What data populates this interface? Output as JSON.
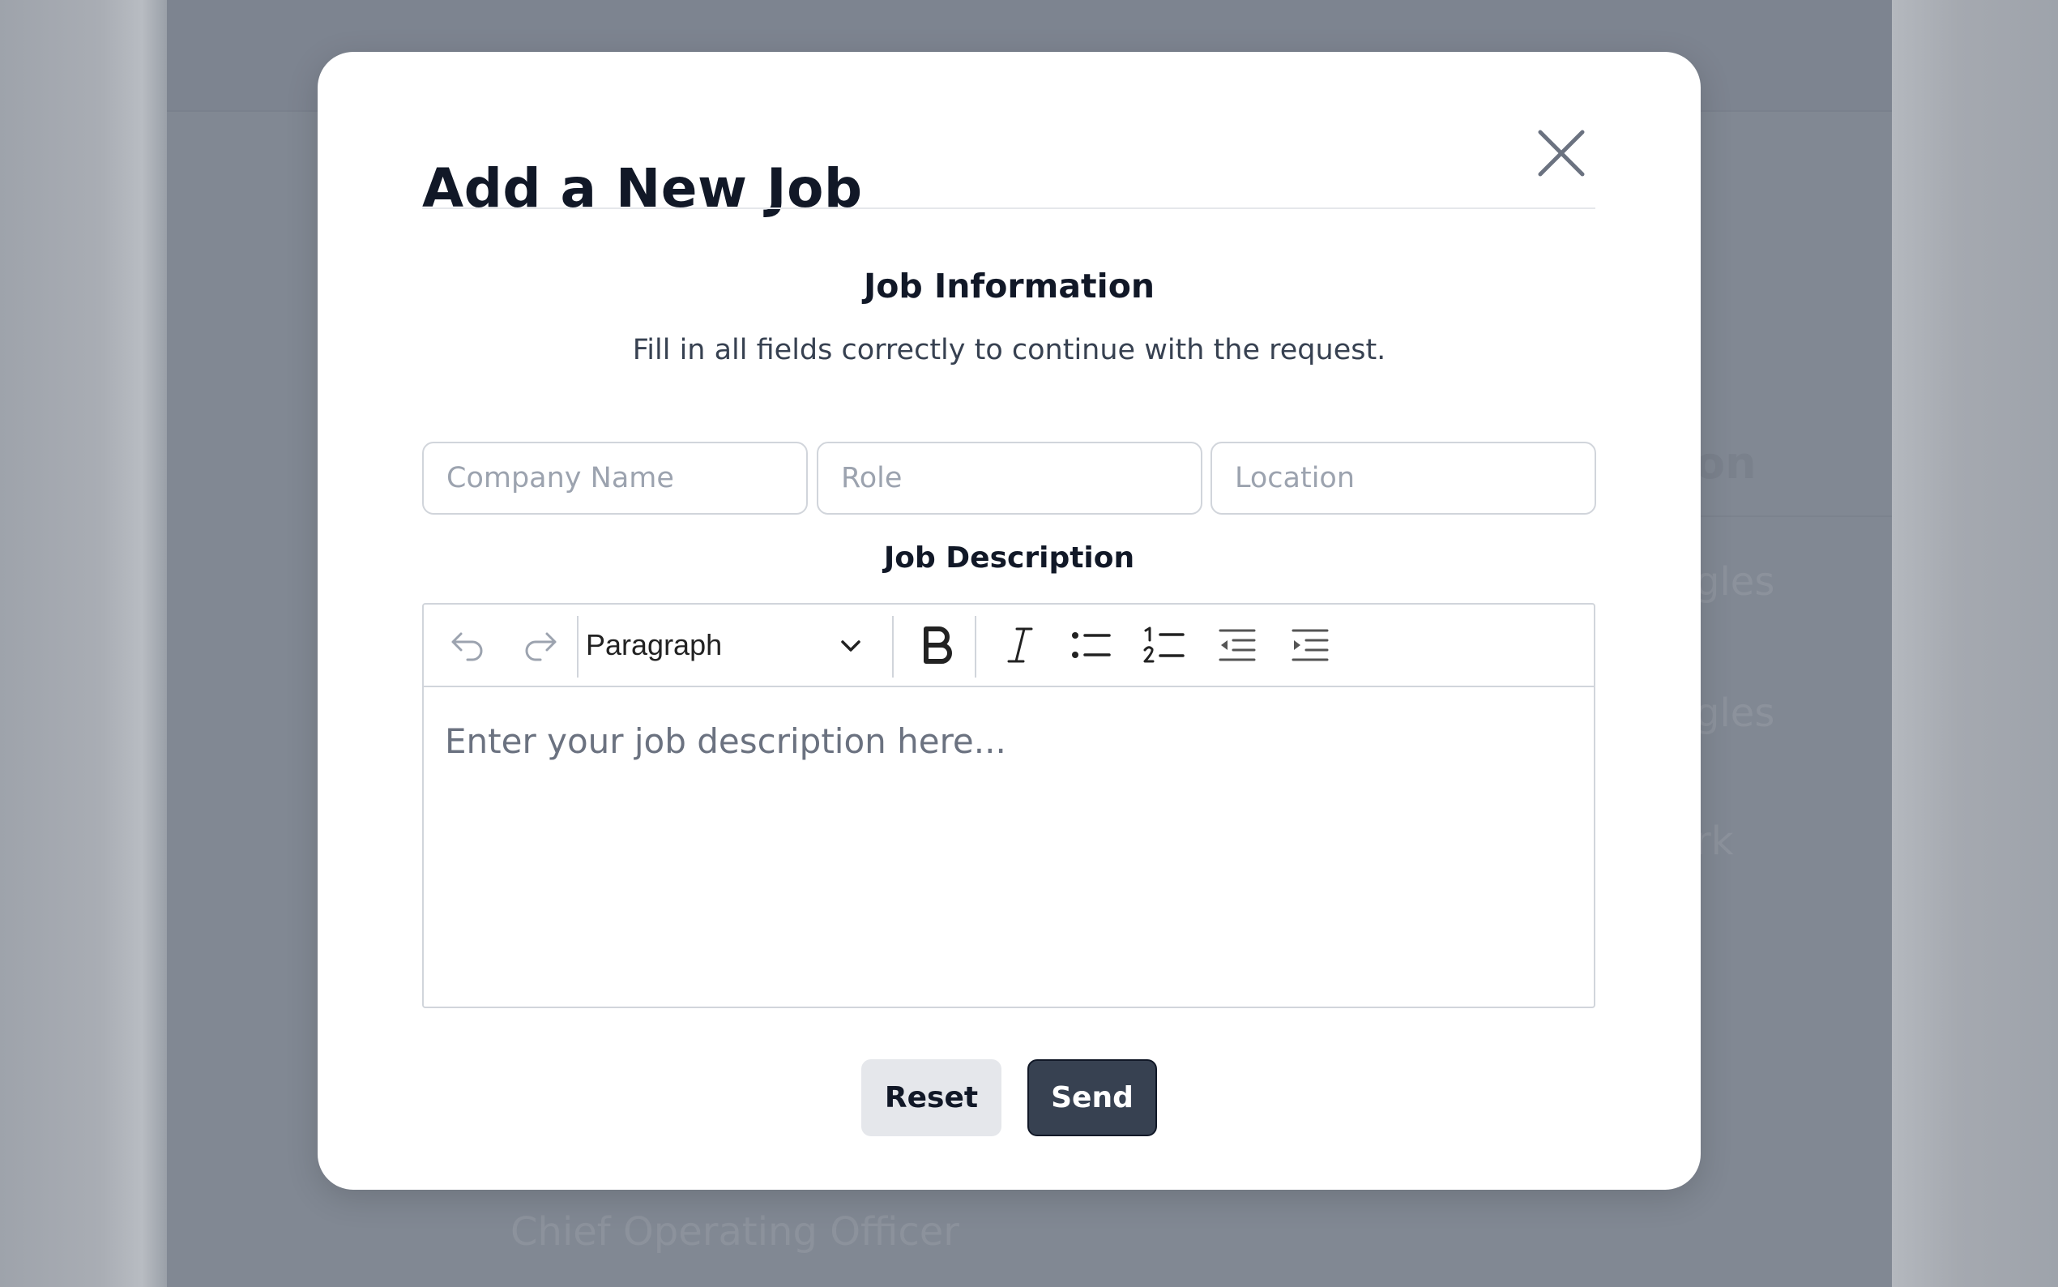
{
  "modal": {
    "title": "Add a New Job",
    "close_icon": "close-icon",
    "section_title": "Job Information",
    "section_subtitle": "Fill in all fields correctly to continue with the request.",
    "fields": {
      "company_placeholder": "Company Name",
      "role_placeholder": "Role",
      "location_placeholder": "Location"
    },
    "description_label": "Job Description",
    "editor": {
      "block_format": "Paragraph",
      "placeholder": "Enter your job description here...",
      "toolbar_icons": [
        "undo-icon",
        "redo-icon",
        "chevron-down-icon",
        "bold-icon",
        "italic-icon",
        "bullet-list-icon",
        "numbered-list-icon",
        "outdent-icon",
        "indent-icon"
      ]
    },
    "buttons": {
      "reset": "Reset",
      "send": "Send"
    }
  },
  "background": {
    "partial_heading": "on",
    "partial_items": [
      "gles",
      "gles",
      "rk"
    ],
    "partial_footer": "Chief Operating Officer"
  },
  "colors": {
    "overlay": "#818893",
    "primary_button": "#374151",
    "secondary_button": "#e5e7eb",
    "border": "#d1d5db"
  }
}
